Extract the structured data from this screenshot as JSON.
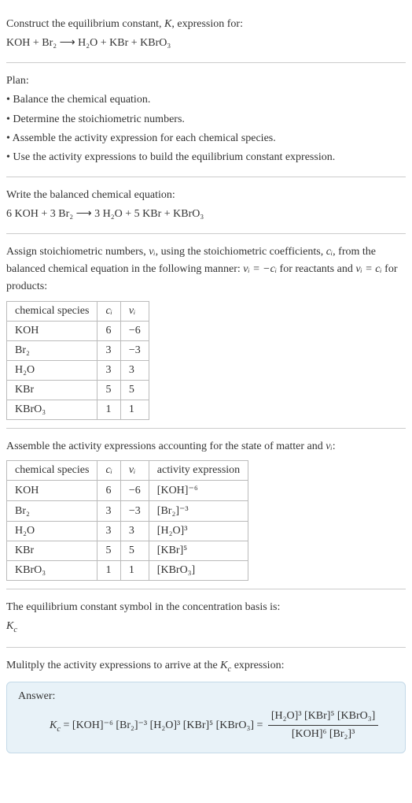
{
  "intro": {
    "line1": "Construct the equilibrium constant, ",
    "Kital": "K",
    "line1b": ", expression for:",
    "reaction": "KOH + Br₂ ⟶ H₂O + KBr + KBrO₃"
  },
  "plan": {
    "title": "Plan:",
    "b1": "• Balance the chemical equation.",
    "b2": "• Determine the stoichiometric numbers.",
    "b3": "• Assemble the activity expression for each chemical species.",
    "b4": "• Use the activity expressions to build the equilibrium constant expression."
  },
  "balanced": {
    "title": "Write the balanced chemical equation:",
    "eq": "6 KOH + 3 Br₂ ⟶ 3 H₂O + 5 KBr + KBrO₃"
  },
  "stoich_text": {
    "part1": "Assign stoichiometric numbers, ",
    "nu": "νᵢ",
    "part2": ", using the stoichiometric coefficients, ",
    "ci": "cᵢ",
    "part3": ", from the balanced chemical equation in the following manner: ",
    "eq1": "νᵢ = −cᵢ",
    "part4": " for reactants and ",
    "eq2": "νᵢ = cᵢ",
    "part5": " for products:"
  },
  "table1": {
    "h1": "chemical species",
    "h2": "cᵢ",
    "h3": "νᵢ",
    "rows": [
      {
        "s": "KOH",
        "c": "6",
        "v": "−6"
      },
      {
        "s": "Br₂",
        "c": "3",
        "v": "−3"
      },
      {
        "s": "H₂O",
        "c": "3",
        "v": "3"
      },
      {
        "s": "KBr",
        "c": "5",
        "v": "5"
      },
      {
        "s": "KBrO₃",
        "c": "1",
        "v": "1"
      }
    ]
  },
  "assemble": {
    "part1": "Assemble the activity expressions accounting for the state of matter and ",
    "nu": "νᵢ",
    "part2": ":"
  },
  "table2": {
    "h1": "chemical species",
    "h2": "cᵢ",
    "h3": "νᵢ",
    "h4": "activity expression",
    "rows": [
      {
        "s": "KOH",
        "c": "6",
        "v": "−6",
        "a": "[KOH]⁻⁶"
      },
      {
        "s": "Br₂",
        "c": "3",
        "v": "−3",
        "a": "[Br₂]⁻³"
      },
      {
        "s": "H₂O",
        "c": "3",
        "v": "3",
        "a": "[H₂O]³"
      },
      {
        "s": "KBr",
        "c": "5",
        "v": "5",
        "a": "[KBr]⁵"
      },
      {
        "s": "KBrO₃",
        "c": "1",
        "v": "1",
        "a": "[KBrO₃]"
      }
    ]
  },
  "kc_symbol": {
    "line1": "The equilibrium constant symbol in the concentration basis is:",
    "kc": "K",
    "kcsub": "c"
  },
  "multiply": {
    "part1": "Mulitply the activity expressions to arrive at the ",
    "kc": "K",
    "kcsub": "c",
    "part2": " expression:"
  },
  "answer": {
    "label": "Answer:",
    "kc": "K",
    "kcsub": "c",
    "eq_left": " = [KOH]⁻⁶ [Br₂]⁻³ [H₂O]³ [KBr]⁵ [KBrO₃] = ",
    "num": "[H₂O]³ [KBr]⁵ [KBrO₃]",
    "den": "[KOH]⁶ [Br₂]³"
  }
}
